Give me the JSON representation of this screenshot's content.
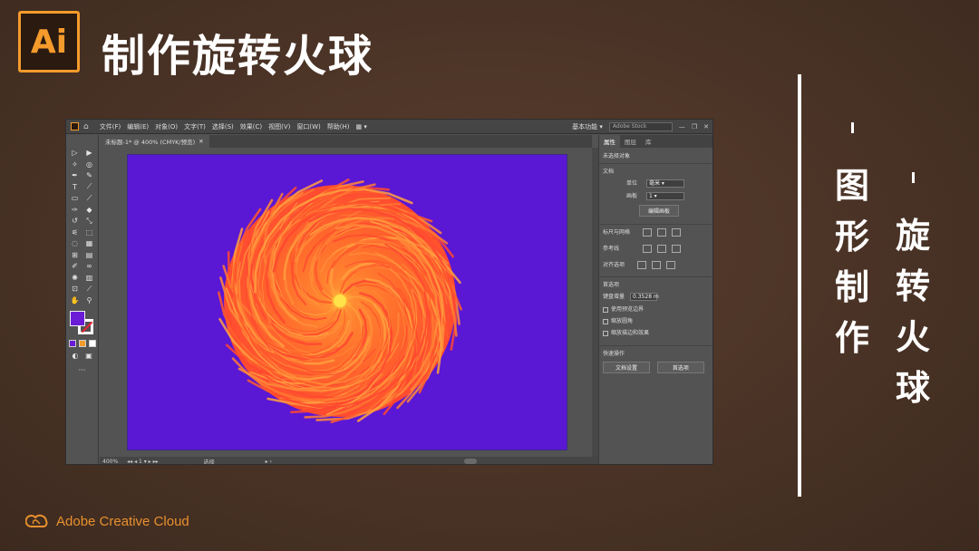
{
  "header": {
    "logo_text": "Ai",
    "title": "制作旋转火球"
  },
  "side_text": {
    "col1": [
      "图",
      "形",
      "制",
      "作"
    ],
    "col2": [
      "旋",
      "转",
      "火",
      "球"
    ]
  },
  "footer": {
    "brand": "Adobe Creative Cloud"
  },
  "app": {
    "menu": [
      "文件(F)",
      "编辑(E)",
      "对象(O)",
      "文字(T)",
      "选择(S)",
      "效果(C)",
      "视图(V)",
      "窗口(W)",
      "帮助(H)"
    ],
    "workspace": "基本功能",
    "search_placeholder": "Adobe Stock",
    "doc_tab": "未标题-1* @ 400% (CMYK/预览)",
    "status": {
      "zoom": "400%",
      "artboard_num": "1",
      "tool": "选择"
    },
    "panel": {
      "tabs": [
        "属性",
        "图层",
        "库"
      ],
      "no_selection": "未选择对象",
      "doc_label": "文档",
      "unit_label": "单位",
      "unit_value": "毫米",
      "artboard_label": "画板",
      "artboard_value": "1",
      "edit_artboard": "编辑画板",
      "rulers_grids": "标尺与网格",
      "guides": "参考线",
      "align": "对齐选项",
      "prefs": "首选项",
      "keyboard_increment_label": "键盘增量",
      "keyboard_increment": "0.3528 m",
      "opt1": "使用预览边界",
      "opt2": "缩放圆角",
      "opt3": "缩放描边和效果",
      "quick_actions": "快速操作",
      "doc_setup": "文档设置",
      "preferences_btn": "首选项"
    }
  },
  "colors": {
    "accent": "#f59b2c",
    "bg": "#4a3326",
    "artboard": "#5a17d4",
    "fire": "#ff5a2a"
  }
}
